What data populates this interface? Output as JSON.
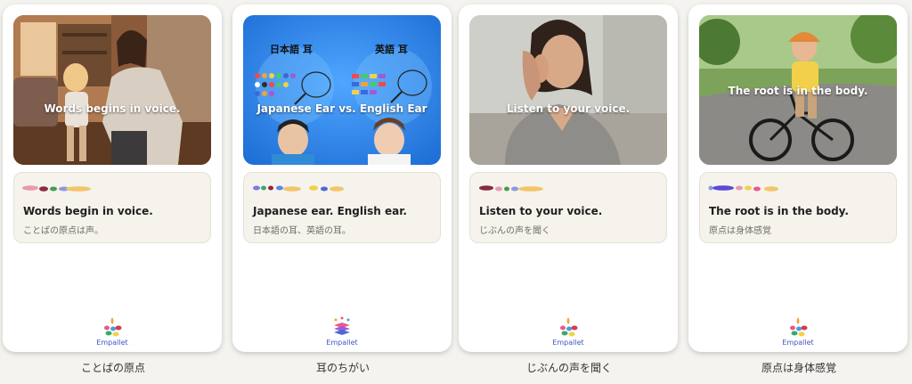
{
  "cards": [
    {
      "overlay": "Words begins in voice.",
      "title": "Words begin in voice.",
      "subtitle": "ことばの原点は声。",
      "logo": "Empallet",
      "caption": "ことばの原点"
    },
    {
      "overlay": "Japanese Ear vs. English Ear",
      "labels": {
        "left": "日本語 耳",
        "right": "英語 耳"
      },
      "title": "Japanese ear. English ear.",
      "subtitle": "日本語の耳、英語の耳。",
      "logo": "Empallet",
      "caption": "耳のちがい"
    },
    {
      "overlay": "Listen to your voice.",
      "title": "Listen to your voice.",
      "subtitle": "じぶんの声を聞く",
      "logo": "Empallet",
      "caption": "じぶんの声を聞く"
    },
    {
      "overlay": "The root is in the body.",
      "title": "The root is in the body.",
      "subtitle": "原点は身体感覚",
      "logo": "Empallet",
      "caption": "原点は身体感覚"
    }
  ]
}
